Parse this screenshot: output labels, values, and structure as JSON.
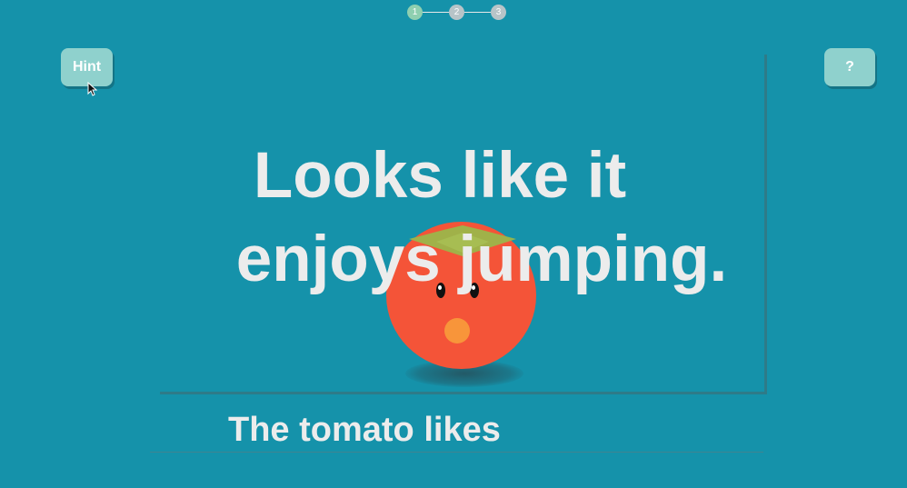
{
  "stepper": {
    "steps": [
      {
        "label": "1",
        "state": "active"
      },
      {
        "label": "2",
        "state": "pending"
      },
      {
        "label": "3",
        "state": "pending"
      }
    ],
    "colors": {
      "active": "#8fcfb0",
      "pending": "#b7c4c8"
    }
  },
  "buttons": {
    "hint_label": "Hint",
    "help_label": "?"
  },
  "question": {
    "line1": "Looks like it",
    "line2": "enjoys jumping."
  },
  "answer": {
    "prompt": "The tomato likes"
  },
  "colors": {
    "background": "#1592aa",
    "button": "#8fd1cd",
    "text": "#ececec",
    "tomato": "#f45438",
    "tomato_leaf": "#9bb64a",
    "tomato_mouth": "#f8953a"
  }
}
